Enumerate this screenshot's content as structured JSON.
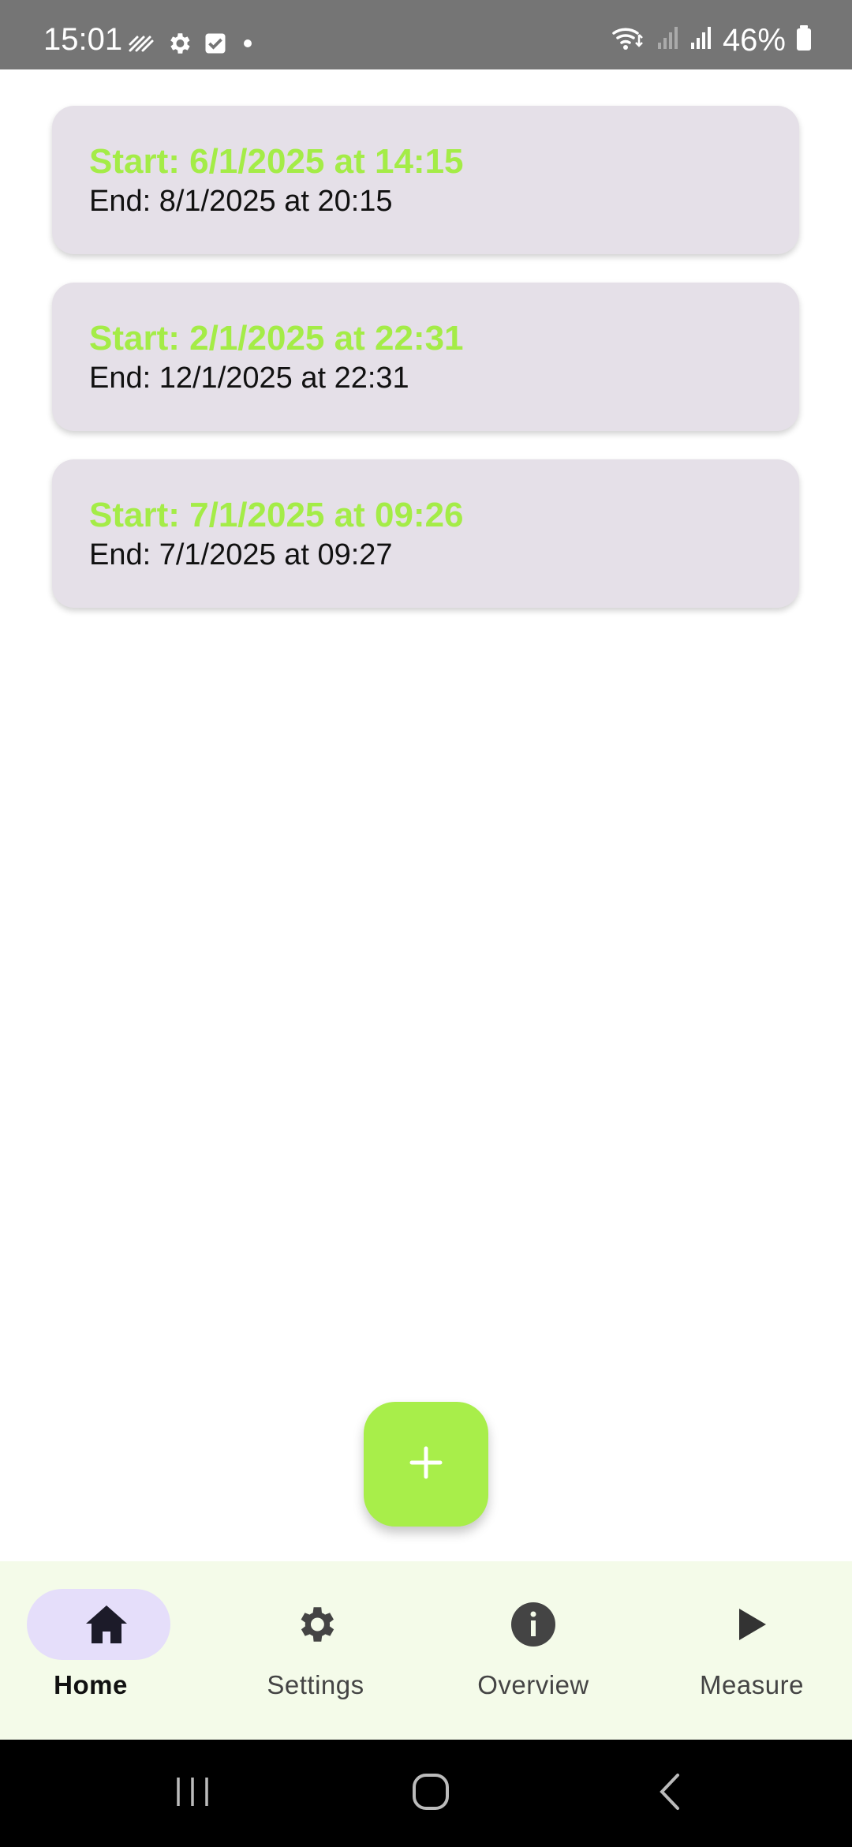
{
  "status_bar": {
    "time": "15:01",
    "battery": "46%",
    "left_icons": [
      "activity-icon",
      "settings-icon",
      "checkbox-icon",
      "dot-icon"
    ],
    "right_icons": [
      "wifi-icon",
      "signal-icon",
      "signal-icon",
      "battery-icon"
    ]
  },
  "sessions": [
    {
      "start": "Start: 6/1/2025 at 14:15",
      "end": "End: 8/1/2025 at 20:15"
    },
    {
      "start": "Start: 2/1/2025 at 22:31",
      "end": "End: 12/1/2025 at 22:31"
    },
    {
      "start": "Start: 7/1/2025 at 09:26",
      "end": "End: 7/1/2025 at 09:27"
    }
  ],
  "fab": {
    "icon": "plus-icon"
  },
  "bottom_nav": {
    "items": [
      {
        "label": "Home",
        "icon": "home-icon",
        "active": true
      },
      {
        "label": "Settings",
        "icon": "gear-icon",
        "active": false
      },
      {
        "label": "Overview",
        "icon": "info-icon",
        "active": false
      },
      {
        "label": "Measure",
        "icon": "play-icon",
        "active": false
      }
    ]
  },
  "colors": {
    "accent": "#a8ee4a",
    "start_text": "#a4ec47",
    "card_bg": "#e5e0e8",
    "nav_bg": "#f4fbe9",
    "nav_active_pill": "#e5defa",
    "status_bar_bg": "#757575"
  }
}
